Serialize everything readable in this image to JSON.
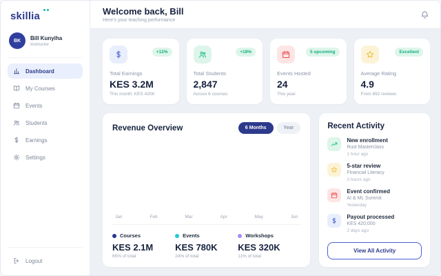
{
  "brand": {
    "logo_text": "skillia",
    "dot_color": "#14b8a6"
  },
  "user": {
    "initials": "BK",
    "name": "Bill Kunyiha",
    "role": "Instructor"
  },
  "sidebar": {
    "items": [
      {
        "label": "Dashboard",
        "icon": "bar-chart-icon",
        "active": true
      },
      {
        "label": "My Courses",
        "icon": "book-icon",
        "active": false
      },
      {
        "label": "Events",
        "icon": "calendar-icon",
        "active": false
      },
      {
        "label": "Students",
        "icon": "users-icon",
        "active": false
      },
      {
        "label": "Earnings",
        "icon": "dollar-icon",
        "active": false
      },
      {
        "label": "Settings",
        "icon": "gear-icon",
        "active": false
      }
    ],
    "logout_label": "Logout"
  },
  "header": {
    "title": "Welcome back, Bill",
    "subtitle": "Here's your teaching performance",
    "bell_icon": "bell-icon"
  },
  "stats": [
    {
      "label": "Total Earnings",
      "value": "KES 3.2M",
      "sub": "This month: KES 420K",
      "badge": "+12%",
      "icon": "dollar-icon",
      "tile_color": "#e8eefb"
    },
    {
      "label": "Total Students",
      "value": "2,847",
      "sub": "Across 6 courses",
      "badge": "+18%",
      "icon": "users-icon",
      "tile_color": "#ddf5ea"
    },
    {
      "label": "Events Hosted",
      "value": "24",
      "sub": "This year",
      "badge": "5 upcoming",
      "icon": "calendar-icon",
      "tile_color": "#fde5e5"
    },
    {
      "label": "Average Rating",
      "value": "4.9",
      "sub": "From 892 reviews",
      "badge": "Excellent",
      "icon": "star-icon",
      "tile_color": "#fcf3d7"
    }
  ],
  "revenue": {
    "title": "Revenue Overview",
    "toggle": {
      "options": [
        "6 Months",
        "Year"
      ],
      "selected": "6 Months"
    },
    "months": [
      "Jan",
      "Feb",
      "Mar",
      "Apr",
      "May",
      "Jun"
    ],
    "legend": [
      {
        "name": "Courses",
        "value": "KES 2.1M",
        "share": "65% of total",
        "color": "#283593"
      },
      {
        "name": "Events",
        "value": "KES 780K",
        "share": "24% of total",
        "color": "#26c6da"
      },
      {
        "name": "Workshops",
        "value": "KES 320K",
        "share": "11% of total",
        "color": "#a78bfa"
      }
    ]
  },
  "activity": {
    "title": "Recent Activity",
    "items": [
      {
        "title": "New enrollment",
        "subtitle": "Rust Masterclass",
        "time": "1 hour ago",
        "icon": "trend-up-icon"
      },
      {
        "title": "5-star review",
        "subtitle": "Financial Literacy",
        "time": "3 hours ago",
        "icon": "star-icon"
      },
      {
        "title": "Event confirmed",
        "subtitle": "AI & ML Summit",
        "time": "Yesterday",
        "icon": "calendar-icon"
      },
      {
        "title": "Payout processed",
        "subtitle": "KES 420,000",
        "time": "2 days ago",
        "icon": "dollar-icon"
      }
    ],
    "view_all_label": "View All Activity"
  },
  "colors": {
    "primary_navy": "#2d3a8c",
    "accent_teal": "#14b8a6",
    "badge_green": "#0faf7d",
    "main_bg": "#edf0f5"
  }
}
